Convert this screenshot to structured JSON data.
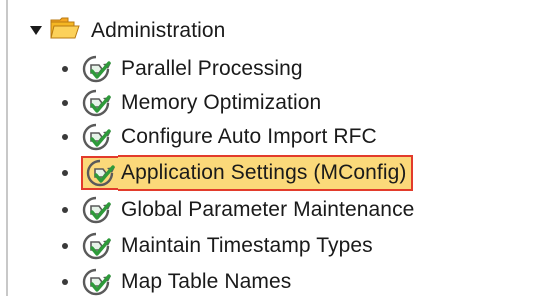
{
  "tree": {
    "root": {
      "label": "Administration",
      "expanded": true,
      "icon": "folder-open-icon"
    },
    "items": [
      {
        "label": "Parallel Processing",
        "icon": "transaction-icon",
        "selected": false
      },
      {
        "label": "Memory Optimization",
        "icon": "transaction-icon",
        "selected": false
      },
      {
        "label": "Configure Auto Import RFC",
        "icon": "transaction-icon",
        "selected": false
      },
      {
        "label": "Application Settings (MConfig)",
        "icon": "transaction-icon",
        "selected": true
      },
      {
        "label": "Global Parameter Maintenance",
        "icon": "transaction-icon",
        "selected": false
      },
      {
        "label": "Maintain Timestamp Types",
        "icon": "transaction-icon",
        "selected": false
      },
      {
        "label": "Map Table Names",
        "icon": "transaction-icon",
        "selected": false
      }
    ]
  },
  "colors": {
    "selection_fill": "#fbd97a",
    "selection_border": "#e23b2b",
    "folder": "#f5b623",
    "icon_green": "#2e9a3a"
  }
}
